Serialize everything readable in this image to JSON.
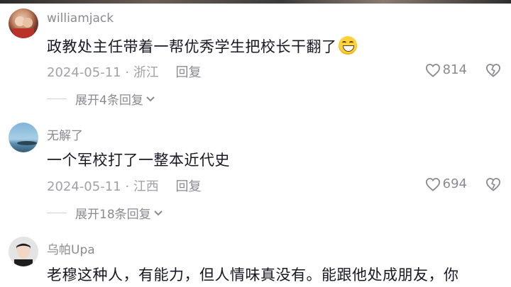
{
  "comments": [
    {
      "username": "williamjack",
      "text": "政教处主任带着一帮优秀学生把校长干翻了",
      "emoji": "grinning-squint-emoji",
      "date": "2024-05-11",
      "location": "浙江",
      "reply_label": "回复",
      "likes": "814",
      "expand_label": "展开4条回复"
    },
    {
      "username": "无解了",
      "text": "一个军校打了一整本近代史",
      "date": "2024-05-11",
      "location": "江西",
      "reply_label": "回复",
      "likes": "694",
      "expand_label": "展开18条回复"
    },
    {
      "username": "乌帕Upa",
      "text": "老穆这种人，有能力，但人情味真没有。能跟他处成朋友，你"
    }
  ],
  "separator": "·",
  "colors": {
    "text": "#161823",
    "meta": "#a1a2a7",
    "username": "#8a8b91"
  }
}
